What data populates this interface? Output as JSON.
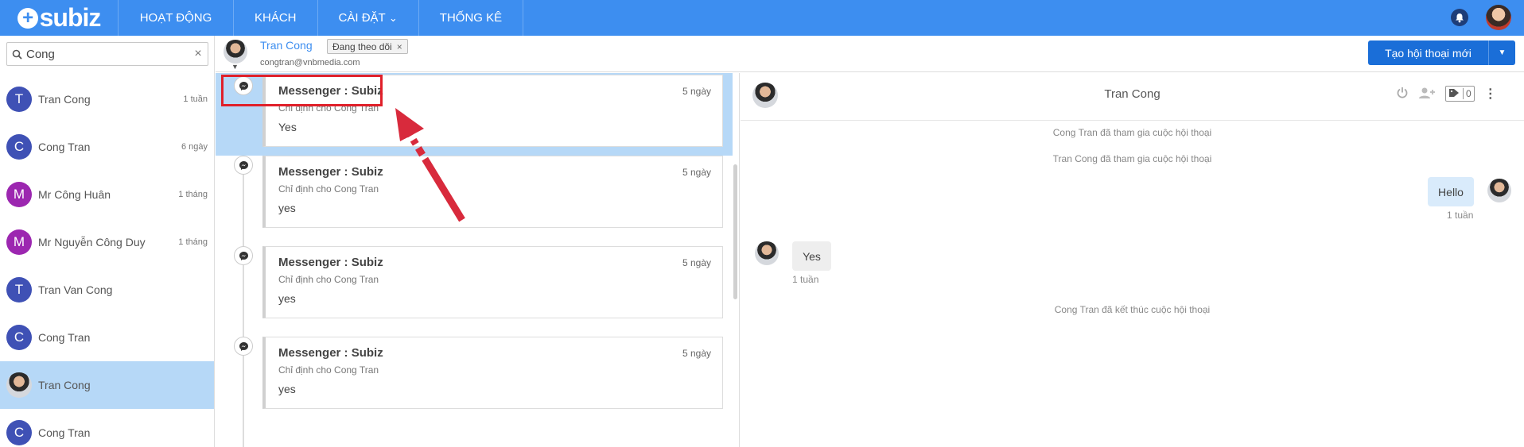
{
  "app": {
    "logo": "subiz"
  },
  "nav": {
    "items": [
      "HOẠT ĐỘNG",
      "KHÁCH",
      "CÀI ĐẶT",
      "THỐNG KÊ"
    ],
    "settings_caret": "⌄"
  },
  "search": {
    "value": "Cong",
    "clear": "×"
  },
  "contacts": [
    {
      "initial": "T",
      "name": "Tran Cong",
      "time": "1 tuần",
      "color": "#3f51b5"
    },
    {
      "initial": "C",
      "name": "Cong Tran",
      "time": "6 ngày",
      "color": "#3f51b5"
    },
    {
      "initial": "M",
      "name": "Mr Công Huân",
      "time": "1 tháng",
      "color": "#9c27b0"
    },
    {
      "initial": "M",
      "name": "Mr Nguyễn Công Duy",
      "time": "1 tháng",
      "color": "#9c27b0"
    },
    {
      "initial": "T",
      "name": "Tran Van Cong",
      "time": "",
      "color": "#3f51b5"
    },
    {
      "initial": "C",
      "name": "Cong Tran",
      "time": "",
      "color": "#3f51b5"
    },
    {
      "initial": "",
      "name": "Tran Cong",
      "time": "",
      "color": "#cccccc"
    },
    {
      "initial": "C",
      "name": "Cong Tran",
      "time": "",
      "color": "#3f51b5"
    }
  ],
  "header": {
    "name": "Tran Cong",
    "email": "congtran@vnbmedia.com",
    "tag": "Đang theo dõi",
    "tag_close": "×",
    "new_conversation": "Tạo hội thoại mới",
    "dropdown_caret": "▼"
  },
  "conversations": [
    {
      "title": "Messenger : Subiz",
      "time": "5 ngày",
      "sub": "Chỉ định cho Cong Tran",
      "body": "Yes"
    },
    {
      "title": "Messenger : Subiz",
      "time": "5 ngày",
      "sub": "Chỉ định cho Cong Tran",
      "body": "yes"
    },
    {
      "title": "Messenger : Subiz",
      "time": "5 ngày",
      "sub": "Chỉ định cho Cong Tran",
      "body": "yes"
    },
    {
      "title": "Messenger : Subiz",
      "time": "5 ngày",
      "sub": "Chỉ định cho Cong Tran",
      "body": "yes"
    }
  ],
  "chat": {
    "name": "Tran Cong",
    "tag_count": "0",
    "system_1": "Cong Tran đã tham gia cuộc hội thoại",
    "system_2": "Tran Cong đã tham gia cuộc hội thoại",
    "out_message": "Hello",
    "out_time": "1 tuần",
    "in_message": "Yes",
    "in_time": "1 tuần",
    "system_3": "Cong Tran đã kết thúc cuộc hội thoại"
  },
  "colors": {
    "brand": "#3d8ef0",
    "button": "#1a6ed8",
    "selected": "#b6d8f7",
    "highlight": "#e0202a"
  },
  "icons": [
    "search-icon",
    "close-icon",
    "bell-icon",
    "messenger-icon",
    "power-icon",
    "add-user-icon",
    "tag-icon",
    "more-icon",
    "chevron-down-icon"
  ]
}
